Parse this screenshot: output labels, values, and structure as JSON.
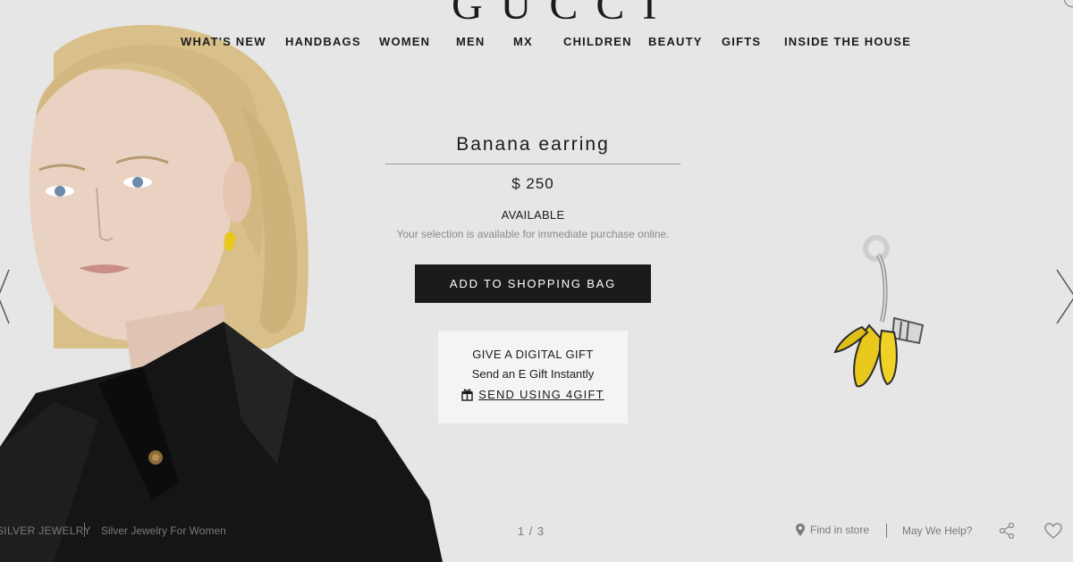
{
  "brand": {
    "logo_text": "GUCCI"
  },
  "nav": {
    "items": [
      {
        "label": "WHAT'S NEW"
      },
      {
        "label": "HANDBAGS"
      },
      {
        "label": "WOMEN"
      },
      {
        "label": "MEN"
      },
      {
        "label": "MX"
      },
      {
        "label": "CHILDREN"
      },
      {
        "label": "BEAUTY"
      },
      {
        "label": "GIFTS"
      },
      {
        "label": "INSIDE THE HOUSE"
      }
    ]
  },
  "product": {
    "title": "Banana earring",
    "price": "$ 250",
    "availability": "AVAILABLE",
    "availability_note": "Your selection is available for immediate purchase online.",
    "add_to_bag_label": "ADD TO SHOPPING BAG"
  },
  "gift": {
    "title": "GIVE A DIGITAL GIFT",
    "subtitle": "Send an E Gift Instantly",
    "link_label": "SEND USING 4GIFT",
    "icon": "gift-box-icon"
  },
  "footer": {
    "breadcrumb_1": "SILVER JEWELRY",
    "breadcrumb_2": "Silver Jewelry For Women",
    "pager": "1 / 3",
    "find_in_store": "Find in store",
    "help": "May We Help?",
    "icons": [
      "location-pin-icon",
      "share-icon",
      "heart-icon"
    ]
  },
  "colors": {
    "background": "#e6e6e6",
    "button": "#1b1b1b",
    "gift_panel": "#f4f4f4",
    "earring_yellow": "#e8c81c"
  }
}
